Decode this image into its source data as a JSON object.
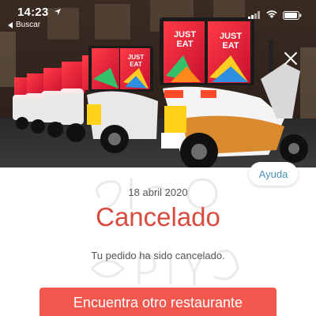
{
  "status_bar": {
    "time": "14:23",
    "back_label": "Buscar"
  },
  "hero": {
    "brand_text": "JUST EAT"
  },
  "help_button": {
    "label": "Ayuda"
  },
  "order": {
    "date": "18 abril 2020",
    "status": "Cancelado",
    "message": "Tu pedido ha sido cancelado."
  },
  "actions": {
    "find_restaurant_label": "Encuentra otro restaurante"
  },
  "watermark": {
    "text": "Slurpy"
  },
  "colors": {
    "accent_red": "#d94a3f",
    "button_red": "#f2584d",
    "link_blue": "#4a90b8",
    "brand_red": "#e8243c"
  }
}
